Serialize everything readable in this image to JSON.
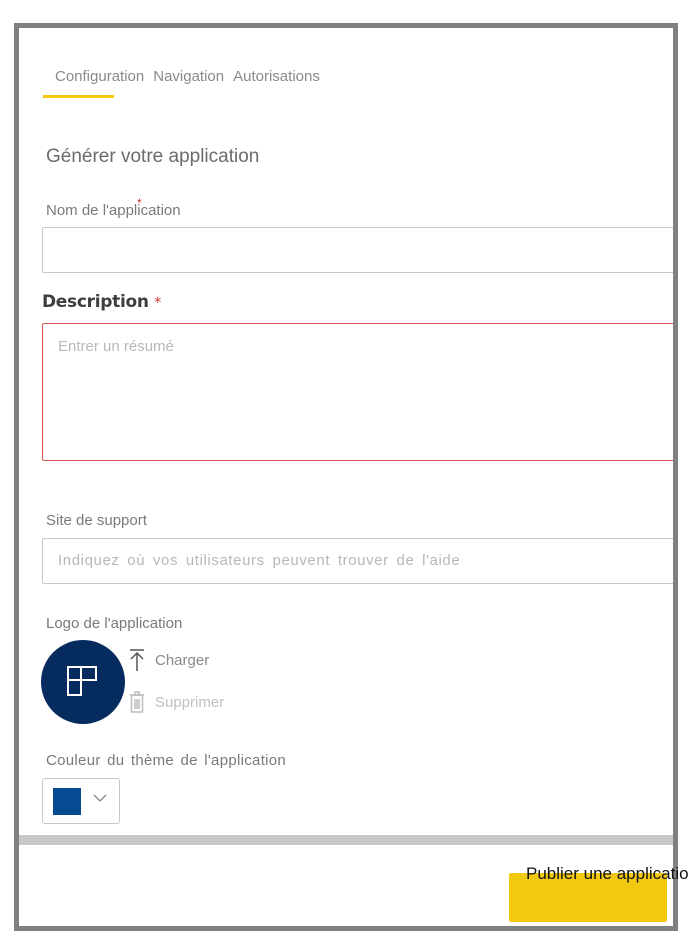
{
  "tabs": [
    {
      "label": "Configuration",
      "active": true
    },
    {
      "label": "Navigation",
      "active": false
    },
    {
      "label": "Autorisations",
      "active": false
    }
  ],
  "accent_color": "#f2c811",
  "page_title": "Générer votre application",
  "app_name": {
    "label": "Nom de l'application",
    "required_mark": "*",
    "value": ""
  },
  "description": {
    "label": "Description",
    "required_mark": "*",
    "placeholder": "Entrer un résumé",
    "value": ""
  },
  "support_site": {
    "label": "Site de support",
    "placeholder": "Indiquez où vos utilisateurs peuvent trouver de l'aide",
    "value": ""
  },
  "logo": {
    "label": "Logo de l'application",
    "upload_label": "Charger",
    "delete_label": "Supprimer",
    "logo_color": "#062b5e"
  },
  "theme_color": {
    "label": "Couleur du thème de l'application",
    "selected_color": "#044b91"
  },
  "publish_button": {
    "label": "Publier une application"
  }
}
